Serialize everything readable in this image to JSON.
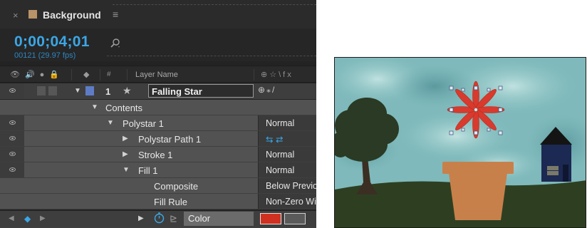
{
  "timeline": {
    "close_glyph": "×",
    "panel_title": "Background",
    "menu_glyph": "≡",
    "timecode": "0;00;04;01",
    "frame_info": "00121 (29.97 fps)",
    "column_header": {
      "num_label": "#",
      "layer_name_label": "Layer Name",
      "switch_glyphs": "⊕☆\\fx"
    },
    "layer": {
      "number": "1",
      "name": "Falling Star",
      "label_color": "#5e7cc6",
      "switches": "⊕⁎/"
    },
    "rows": [
      {
        "name": "Contents",
        "mode": ""
      },
      {
        "name": "Polystar 1",
        "mode": "Normal"
      },
      {
        "name": "Polystar Path 1",
        "mode": "⇆ ⇄"
      },
      {
        "name": "Stroke 1",
        "mode": "Normal"
      },
      {
        "name": "Fill 1",
        "mode": "Normal"
      },
      {
        "name": "Composite",
        "mode": "Below Previous"
      },
      {
        "name": "Fill Rule",
        "mode": "Non-Zero Winding"
      }
    ],
    "color_property": {
      "label": "Color",
      "value": "#d0301f"
    }
  },
  "composition": {
    "accent_colors": {
      "sky": "#8ec4c4",
      "ground": "#2e3f21",
      "pot": "#c8804b",
      "star": "#d83a2d",
      "house": "#1c2952",
      "tree": "#2a3a24"
    }
  }
}
